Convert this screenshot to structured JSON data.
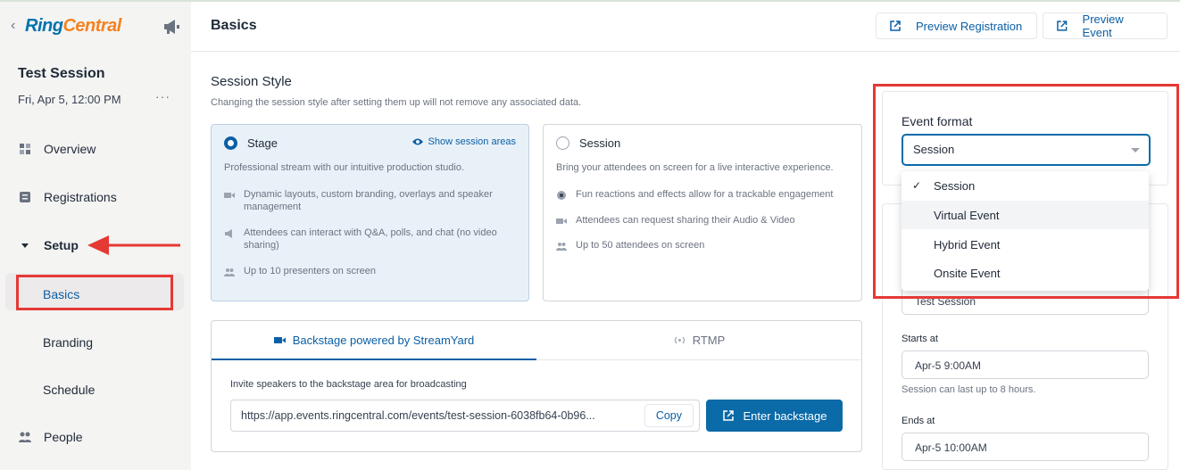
{
  "brand": {
    "ring": "Ring",
    "central": "Central"
  },
  "sidebar": {
    "session_title": "Test Session",
    "session_date": "Fri, Apr 5, 12:00 PM",
    "more": "···",
    "items": {
      "overview": "Overview",
      "registrations": "Registrations",
      "setup": "Setup",
      "basics": "Basics",
      "branding": "Branding",
      "schedule": "Schedule",
      "people": "People"
    }
  },
  "header": {
    "title": "Basics",
    "preview_registration": "Preview Registration",
    "preview_event": "Preview Event"
  },
  "session_style": {
    "title": "Session Style",
    "note": "Changing the session style after setting them up will not remove any associated data.",
    "stage": {
      "title": "Stage",
      "link": "Show session areas",
      "desc": "Professional stream with our intuitive production studio.",
      "features": [
        "Dynamic layouts, custom branding, overlays and speaker management",
        "Attendees can interact with Q&A, polls, and chat (no video sharing)",
        "Up to 10 presenters on screen"
      ]
    },
    "session": {
      "title": "Session",
      "desc": "Bring your attendees on screen for a live interactive experience.",
      "features": [
        "Fun reactions and effects allow for a trackable engagement",
        "Attendees can request sharing their Audio & Video",
        "Up to 50 attendees on screen"
      ]
    }
  },
  "backstage": {
    "tab_backstage": "Backstage powered by StreamYard",
    "tab_rtmp": "RTMP",
    "invite": "Invite speakers to the backstage area for broadcasting",
    "url": "https://app.events.ringcentral.com/events/test-session-6038fb64-0b96...",
    "copy": "Copy",
    "enter": "Enter backstage"
  },
  "event_format": {
    "label": "Event format",
    "value": "Session",
    "options": [
      "Session",
      "Virtual Event",
      "Hybrid Event",
      "Onsite Event"
    ],
    "selected_mark": "✓"
  },
  "details": {
    "name_value": "Test Session",
    "starts_label": "Starts at",
    "starts_value": "Apr-5 9:00AM",
    "hint": "Session can last up to 8 hours.",
    "ends_label": "Ends at",
    "ends_value": "Apr-5 10:00AM"
  },
  "colors": {
    "accent": "#0b5fa5",
    "annotation": "#e53935",
    "logo_blue": "#0073ae",
    "logo_orange": "#f58220"
  }
}
